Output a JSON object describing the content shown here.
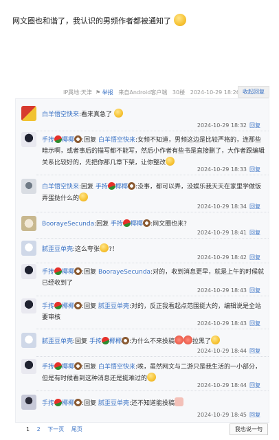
{
  "post": {
    "text": "网文圈也和谐了，我认识的男频作者都被通知了"
  },
  "meta": {
    "ip": "IP属地:天津",
    "report": "举报",
    "from": "来自Android客户端",
    "floor": "30楼",
    "time": "2024-10-29 18:26",
    "collapse": "收起回复"
  },
  "replies": [
    {
      "user": "白羊悟空快来",
      "content": ":看来真急了",
      "time": "2024-10-29 18:32",
      "action": "回复"
    },
    {
      "user": "手抟",
      "user_suffix": "椰椰",
      "reply_prefix": ":回复",
      "target": "白羊悟空快来",
      "content": ":女频不知道，男频这边是比较严格的，连那些暗示啊，或者事后的描写都不能写，然后小作者有些书是直接删了，大作者跟编辑关系比较好的，先把你那几章下架，让你整改",
      "time": "2024-10-29 18:33",
      "action": "回复"
    },
    {
      "user": "白羊悟空快来",
      "reply_prefix": ":回复",
      "target": "手抟",
      "target_suffix": "椰椰",
      "content": ":没事，都可以弄，没娱乐我天天在家里学做饭弄蛋挞什么的",
      "time": "2024-10-29 18:34",
      "action": "回复"
    },
    {
      "user": "BoorayeSecunda",
      "reply_prefix": ":回复",
      "target": "手抟",
      "target_suffix": "椰椰",
      "content": ":网文圈也来?",
      "time": "2024-10-29 18:41",
      "action": "回复"
    },
    {
      "user": "腻歪豆单壳",
      "content": ":这么夸张",
      "content_tail": "?！",
      "time": "2024-10-29 18:42",
      "action": "回复"
    },
    {
      "user": "手抟",
      "user_suffix": "椰椰",
      "reply_prefix": ":回复",
      "target": "BoorayeSecunda",
      "content": ":对的，收到消息更早，就是上午的时候就已经收到了",
      "time": "2024-10-29 18:43",
      "action": "回复"
    },
    {
      "user": "手抟",
      "user_suffix": "椰椰",
      "reply_prefix": ":回复",
      "target": "腻歪豆单壳",
      "content": ":对的，反正我看起点范围挺大的，编辑说是全站要审核",
      "time": "2024-10-29 18:43",
      "action": "回复"
    },
    {
      "user": "腻歪豆单壳",
      "reply_prefix": ":回复",
      "target": "手抟",
      "target_suffix": "椰椰",
      "content": ":为什么不来投稿",
      "content_tail": "拉黑了",
      "time": "2024-10-29 18:44",
      "action": "回复"
    },
    {
      "user": "手抟",
      "user_suffix": "椰椰",
      "reply_prefix": ":回复",
      "target": "白羊悟空快来",
      "content": ":唉，虽然网文与二游只是我生活的一小部分，但是有时候看到这种消息还是挺难过的",
      "time": "2024-10-29 18:44",
      "action": "回复"
    },
    {
      "user": "手抟",
      "user_suffix": "椰椰",
      "reply_prefix": ":回复",
      "target": "腻歪豆单壳",
      "content": ":还不知道能投稿",
      "time": "2024-10-29 18:45",
      "action": "回复"
    }
  ],
  "pager": {
    "p1": "1",
    "p2": "2",
    "next": "下一页",
    "last": "尾页"
  },
  "say_button": "我也说一句"
}
